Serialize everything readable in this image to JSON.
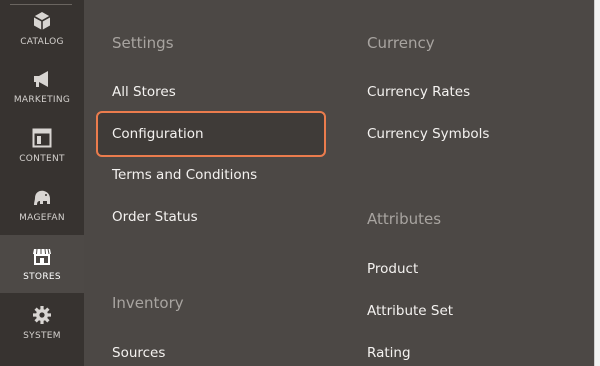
{
  "nav": {
    "items": [
      {
        "label": "CATALOG",
        "icon": "cube-icon"
      },
      {
        "label": "MARKETING",
        "icon": "megaphone-icon"
      },
      {
        "label": "CONTENT",
        "icon": "layout-icon"
      },
      {
        "label": "MAGEFAN",
        "icon": "elephant-icon"
      },
      {
        "label": "STORES",
        "icon": "store-icon",
        "active": true
      },
      {
        "label": "SYSTEM",
        "icon": "gear-icon"
      }
    ]
  },
  "flyout": {
    "settings": {
      "title": "Settings",
      "links": [
        "All Stores",
        "Configuration",
        "Terms and Conditions",
        "Order Status"
      ],
      "highlighted": "Configuration"
    },
    "inventory": {
      "title": "Inventory",
      "links": [
        "Sources"
      ]
    },
    "currency": {
      "title": "Currency",
      "links": [
        "Currency Rates",
        "Currency Symbols"
      ]
    },
    "attributes": {
      "title": "Attributes",
      "links": [
        "Product",
        "Attribute Set",
        "Rating"
      ]
    }
  },
  "colors": {
    "highlight_border": "#eb7c4d",
    "panel_bg": "#4c4845",
    "nav_bg": "#373330"
  }
}
